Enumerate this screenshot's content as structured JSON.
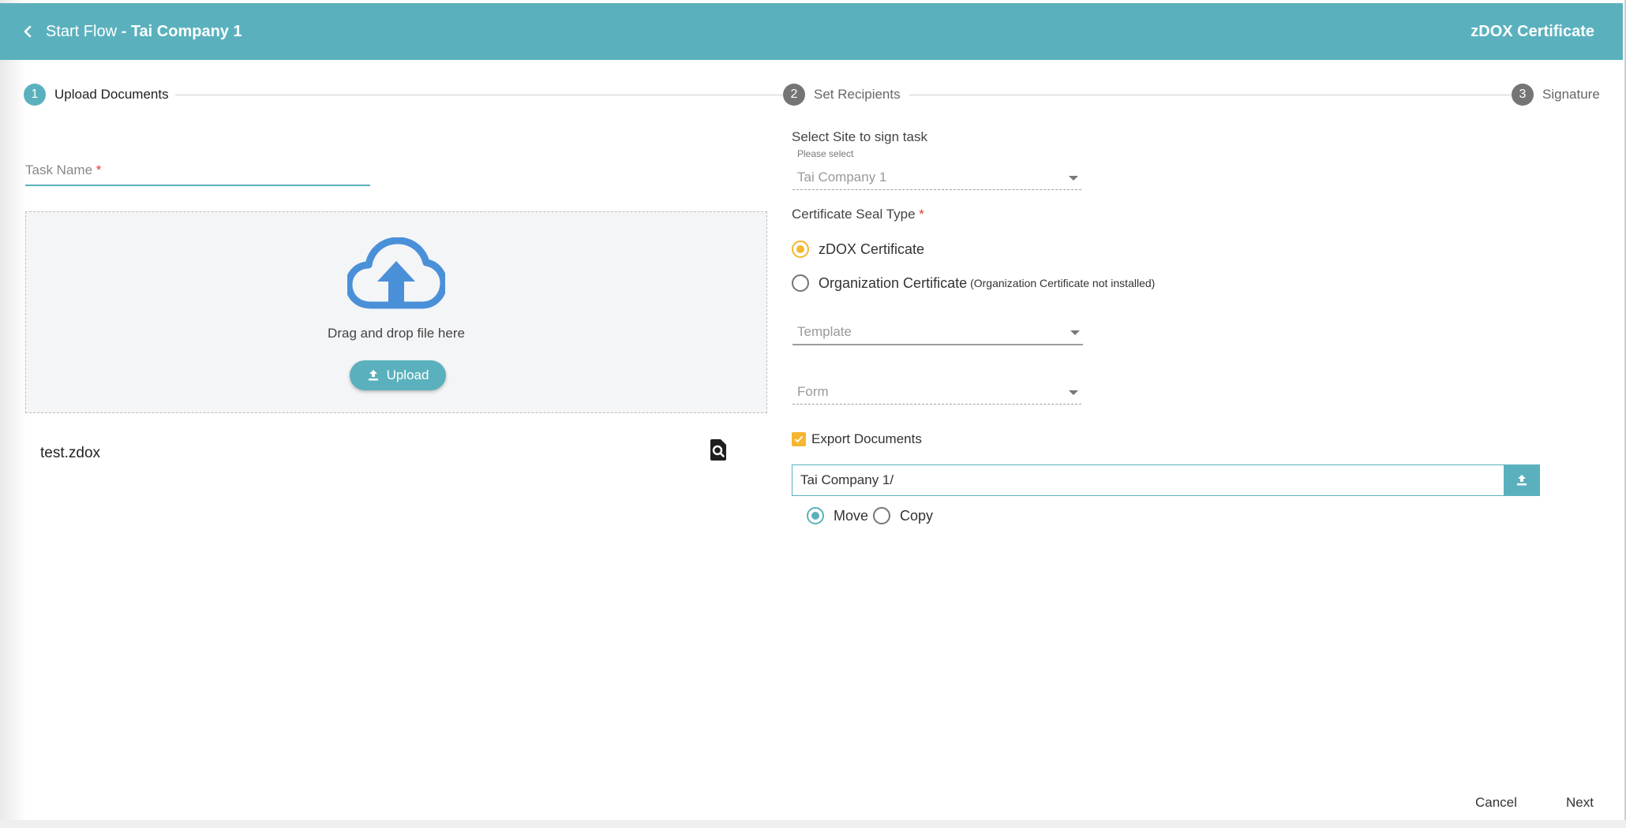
{
  "header": {
    "title_prefix": "Start Flow",
    "title_separator": " - ",
    "title_company": "Tai Company 1",
    "right_title": "zDOX Certificate"
  },
  "steps": [
    {
      "number": "1",
      "label": "Upload Documents",
      "active": true
    },
    {
      "number": "2",
      "label": "Set Recipients",
      "active": false
    },
    {
      "number": "3",
      "label": "Signature",
      "active": false
    }
  ],
  "task_name": {
    "label": "Task Name",
    "required_mark": "*"
  },
  "dropzone": {
    "text": "Drag and drop file here",
    "upload_label": "Upload"
  },
  "file": {
    "name": "test.zdox"
  },
  "site": {
    "label": "Select Site to sign task",
    "sub_label": "Please select",
    "value": "Tai Company 1"
  },
  "seal": {
    "label": "Certificate Seal Type",
    "required_mark": "*",
    "options": [
      {
        "label": "zDOX Certificate",
        "note": "",
        "checked": true
      },
      {
        "label": "Organization Certificate",
        "note": "(Organization Certificate not installed)",
        "checked": false
      }
    ]
  },
  "template": {
    "placeholder": "Template"
  },
  "form": {
    "placeholder": "Form"
  },
  "export": {
    "label": "Export Documents",
    "checked": true,
    "path": "Tai Company 1/",
    "modes": [
      {
        "label": "Move",
        "checked": true
      },
      {
        "label": "Copy",
        "checked": false
      }
    ]
  },
  "footer": {
    "cancel": "Cancel",
    "next": "Next"
  },
  "colors": {
    "primary": "#5ab1bd",
    "accent": "#f5b731",
    "required": "#e53935",
    "inactive_step": "#757575"
  },
  "icons": {
    "back": "chevron-left-icon",
    "cloud": "cloud-upload-icon",
    "upload": "upload-icon",
    "preview": "document-search-icon",
    "path_upload": "upload-icon"
  }
}
